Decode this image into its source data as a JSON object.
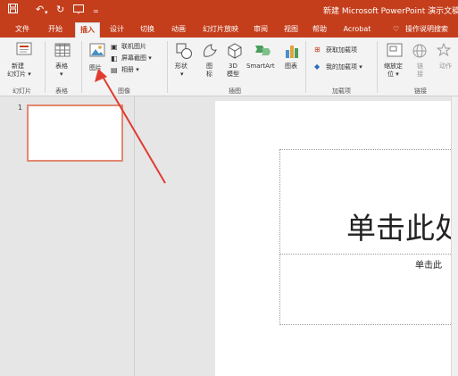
{
  "title_bar": {
    "title": "新建 Microsoft PowerPoint 演示文稿"
  },
  "tabs": [
    "文件",
    "开始",
    "插入",
    "设计",
    "切换",
    "动画",
    "幻灯片放映",
    "审阅",
    "视图",
    "帮助",
    "Acrobat"
  ],
  "search_label": "操作说明搜索",
  "ribbon": {
    "new_slide": "新建\n幻灯片 ▾",
    "new_slide_line1": "新建",
    "new_slide_line2": "幻灯片 ▾",
    "group_slides": "幻灯片",
    "table": "表格",
    "group_tables": "表格",
    "picture": "图片",
    "online_pictures": "联机图片",
    "screenshot": "屏幕截图 ▾",
    "album": "相册 ▾",
    "group_images": "图像",
    "shapes": "形状",
    "icons": "图\n标",
    "icons_line1": "图",
    "icons_line2": "标",
    "model_3d_line1": "3D",
    "model_3d_line2": "模型",
    "smartart": "SmartArt",
    "chart": "图表",
    "group_illustrations": "插图",
    "get_addins": "获取加载项",
    "my_addins": "我的加载项 ▾",
    "group_addins": "加载项",
    "zoom_line1": "缩放定",
    "zoom_line2": "位 ▾",
    "link_line1": "链",
    "link_line2": "接",
    "action": "动作",
    "group_links": "链接"
  },
  "thumbnail_number": "1",
  "slide": {
    "title_placeholder": "单击此处",
    "subtitle_placeholder": "单击此"
  },
  "annotation_color": "#e03c31",
  "accent_color": "#c43e1c"
}
